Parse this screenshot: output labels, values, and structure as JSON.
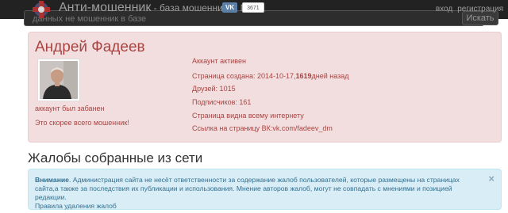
{
  "header": {
    "brand_title": "Анти-мошенник",
    "brand_subtitle": " - база мошенников № 1",
    "vk_button": "VK",
    "vk_count": "3671",
    "search_placeholder": "данных не мошенник в базе",
    "search_button": "Искать",
    "nav": {
      "login": "вход",
      "register": "регистрация"
    }
  },
  "profile": {
    "name": "Андрей Фадеев",
    "status_banned": "аккаунт был забанен",
    "verdict": "Это скорее всего мошенник!",
    "account_status": "Аккаунт активен",
    "created_prefix": "Страница создана: 2014-10-17,",
    "created_days": "1619",
    "created_suffix": "дней назад",
    "friends": "Друзей: 1015",
    "followers": "Подписчиков: 161",
    "visibility": "Страница видна всему интернету",
    "link_label": "Ссылка на страницу ВК:",
    "link_value": "vk.com/fadeev_dm"
  },
  "complaints": {
    "title": "Жалобы собранные из сети"
  },
  "notice": {
    "strong": "Внимание",
    "text": ". Администрация сайта не несёт ответственности за содержание жалоб пользователей, которые размещены на страницах сайта,а также за последствия их публикации и использования. Мнение авторов жалоб, могут не совпадать с мнениями и позицией редакции.",
    "link": "Правила удаления жалоб",
    "close": "×"
  },
  "colors": {
    "danger_bg": "#f2dede",
    "danger_text": "#a94442",
    "info_bg": "#d9edf7",
    "info_text": "#31708f",
    "navbar": "#222222"
  }
}
